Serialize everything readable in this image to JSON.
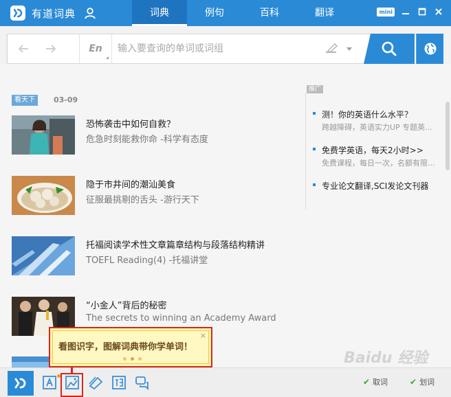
{
  "app": {
    "title": "有道词典"
  },
  "nav": {
    "tabs": [
      "词典",
      "例句",
      "百科",
      "翻译"
    ],
    "active": 0
  },
  "window": {
    "mini_label": "mini"
  },
  "search": {
    "lang": "En",
    "placeholder": "输入要查询的单词或词组",
    "value": ""
  },
  "feed": {
    "tag": "看天下",
    "date": "03-09",
    "articles": [
      {
        "title": "恐怖袭击中如何自救？",
        "subtitle": "危急时刻能救你命 -科学有态度"
      },
      {
        "title": "隐于市井间的潮汕美食",
        "subtitle": "征服最挑剔的舌头 -游行天下"
      },
      {
        "title": "托福阅读学术性文章篇章结构与段落结构精讲",
        "subtitle": "TOEFL Reading(4) -托福讲堂"
      },
      {
        "title": "“小金人”背后的秘密",
        "subtitle": "The secrets to winning an Academy Award"
      }
    ]
  },
  "sidebar": {
    "ad_tag": "推广",
    "items": [
      {
        "title": "测！你的英语什么水平？",
        "subtitle": "跨越障碍，英语实力UP 专题英..."
      },
      {
        "title": "免费学英语，每天2小时>>",
        "subtitle": "免费课程，每日一次，名额有限..."
      },
      {
        "title": "专业论文翻译,SCI发论文刊器",
        "subtitle": ""
      }
    ]
  },
  "popup": {
    "text": "看图识字，图解词典带你学单词！",
    "close": "×"
  },
  "bottom": {
    "options": [
      "取词",
      "划词"
    ]
  },
  "watermark": "Baidu 经验",
  "colors": {
    "brand": "#2b8ad6",
    "highlight": "#d7261b",
    "popup_bg": "#fff6b0"
  }
}
